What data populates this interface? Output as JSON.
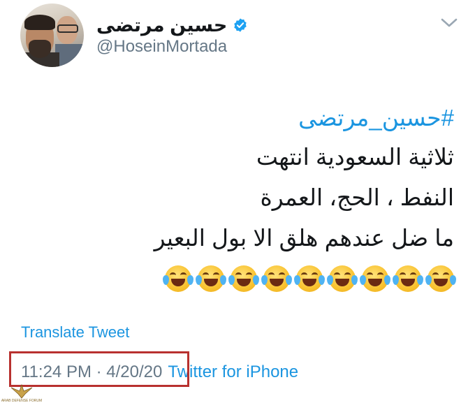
{
  "tweet": {
    "author": {
      "display_name": "حسين مرتضى",
      "handle": "@HoseinMortada",
      "verified": true,
      "avatar": "profile-photo"
    },
    "hashtag": "#حسين_مرتضى",
    "lines": [
      "ثلاثية  السعودية انتهت",
      "النفط ، الحج، العمرة",
      "ما ضل عندهم هلق الا بول البعير"
    ],
    "emojis": {
      "name": "face-with-tears-of-joy",
      "count": 9
    },
    "translate_label": "Translate Tweet",
    "timestamp": "11:24 PM · 4/20/20",
    "separator": "·",
    "source": "Twitter for iPhone"
  },
  "colors": {
    "link": "#1b95e0",
    "text": "#14171a",
    "secondary": "#657786",
    "highlight": "#b8312f"
  },
  "watermark": {
    "text": "ARAB DEFENSE FORUM"
  }
}
